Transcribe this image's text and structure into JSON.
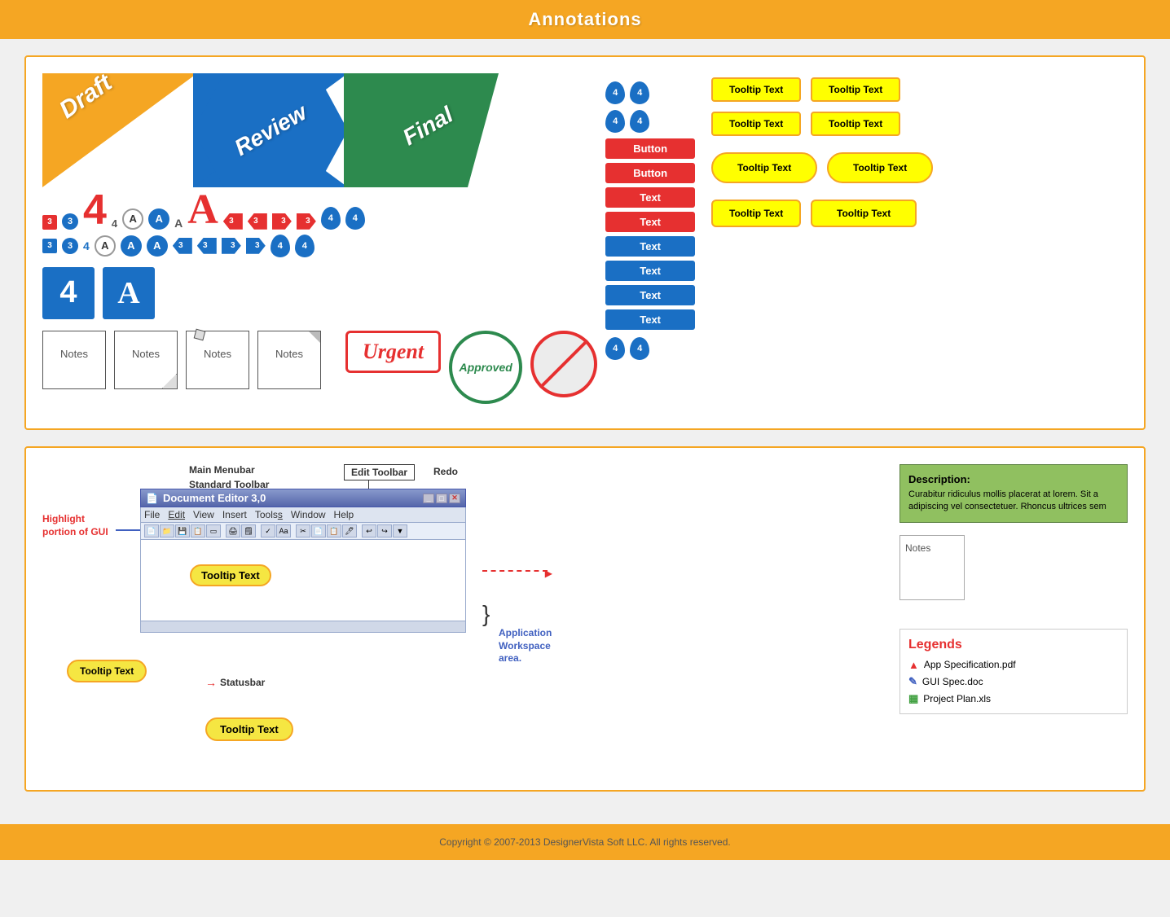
{
  "header": {
    "title": "Annotations"
  },
  "banners": [
    {
      "label": "Draft",
      "color": "#F5A623"
    },
    {
      "label": "Review",
      "color": "#1a6fc4"
    },
    {
      "label": "Final",
      "color": "#2d8a4e"
    }
  ],
  "buttons": [
    {
      "label": "Button",
      "style": "red"
    },
    {
      "label": "Button",
      "style": "red"
    },
    {
      "label": "Text",
      "style": "red"
    },
    {
      "label": "Text",
      "style": "red"
    },
    {
      "label": "Text",
      "style": "blue"
    },
    {
      "label": "Text",
      "style": "blue"
    },
    {
      "label": "Text",
      "style": "blue"
    },
    {
      "label": "Text",
      "style": "blue"
    }
  ],
  "tooltips": {
    "row1": [
      "Tooltip Text",
      "Tooltip Text"
    ],
    "row2": [
      "Tooltip Text",
      "Tooltip Text"
    ],
    "row3": [
      "Tooltip Text",
      "Tooltip Text"
    ],
    "row4": [
      "Tooltip Text",
      "Tooltip Text"
    ]
  },
  "badges": {
    "num3_red": "3",
    "num3_blue": "3",
    "num4_big": "4",
    "num4_small": "4",
    "letterA_white": "A",
    "letterA_blue": "A",
    "letterA_plain": "A",
    "letterA_big_red": "A"
  },
  "notes": [
    "Notes",
    "Notes",
    "Notes",
    "Notes"
  ],
  "stamps": {
    "urgent": "Urgent",
    "approved": "Approved"
  },
  "diagram": {
    "title": "Document Editor 3,0",
    "labels": {
      "main_menubar": "Main Menubar",
      "standard_toolbar": "Standard Toolbar",
      "edit_toolbar": "Edit Toolbar",
      "redo": "Redo",
      "statusbar": "Statusbar",
      "highlight": "Highlight portion of GUI",
      "app_workspace": "Application Workspace area.",
      "tooltip_text_1": "Tooltip Text",
      "tooltip_text_2": "Tooltip Text"
    },
    "description": {
      "title": "Description:",
      "text": "Curabitur ridiculus mollis placerat at lorem. Sit a adipiscing vel consectetuer. Rhoncus ultrices sem"
    },
    "notes_label": "Notes",
    "legends": {
      "title": "Legends",
      "items": [
        {
          "icon": "pdf",
          "label": "App Specification.pdf"
        },
        {
          "icon": "doc",
          "label": "GUI Spec.doc"
        },
        {
          "icon": "xls",
          "label": "Project Plan.xls"
        }
      ]
    },
    "menu_items": [
      "File",
      "Edit",
      "View",
      "Insert",
      "Tools",
      "Window",
      "Help"
    ]
  },
  "footer": {
    "text": "Copyright © 2007-2013 DesignerVista Soft LLC. All rights reserved."
  }
}
